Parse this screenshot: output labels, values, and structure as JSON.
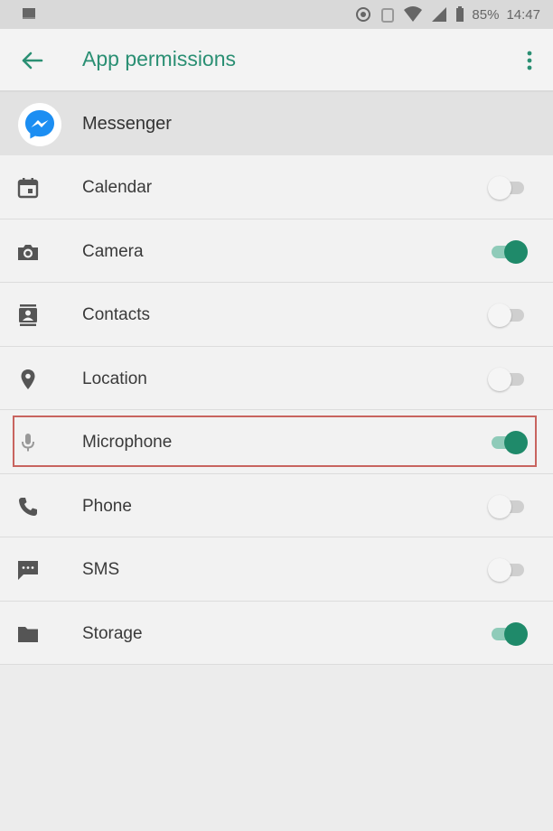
{
  "status_bar": {
    "battery_percent": "85%",
    "time": "14:47",
    "icons": [
      "screen-cast-icon",
      "sync-icon",
      "alarm-icon",
      "wifi-icon",
      "signal-icon",
      "battery-icon"
    ]
  },
  "app_bar": {
    "title": "App permissions",
    "back_icon": "arrow-back-icon",
    "menu_icon": "more-vert-icon"
  },
  "app": {
    "name": "Messenger",
    "icon": "messenger-icon",
    "brand_color": "#1c8ef2"
  },
  "accent_color": "#1f8a6a",
  "highlight_color": "#c8645f",
  "permissions": [
    {
      "label": "Calendar",
      "icon": "calendar-icon",
      "enabled": false
    },
    {
      "label": "Camera",
      "icon": "camera-icon",
      "enabled": true
    },
    {
      "label": "Contacts",
      "icon": "contacts-icon",
      "enabled": false
    },
    {
      "label": "Location",
      "icon": "location-icon",
      "enabled": false
    },
    {
      "label": "Microphone",
      "icon": "microphone-icon",
      "enabled": true,
      "highlighted": true
    },
    {
      "label": "Phone",
      "icon": "phone-icon",
      "enabled": false
    },
    {
      "label": "SMS",
      "icon": "sms-icon",
      "enabled": false
    },
    {
      "label": "Storage",
      "icon": "folder-icon",
      "enabled": true
    }
  ]
}
